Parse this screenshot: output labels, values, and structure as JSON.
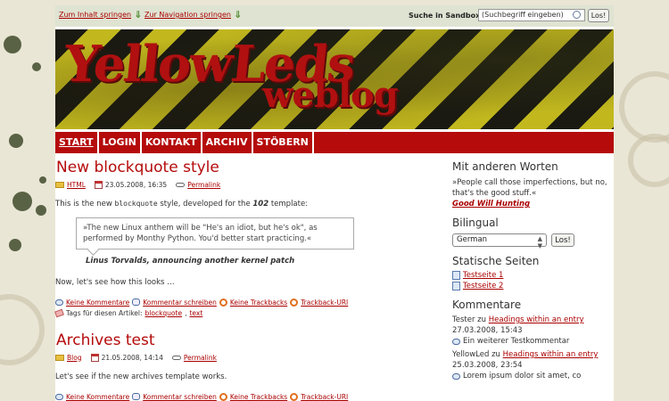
{
  "skiplinks": {
    "content": "Zum Inhalt springen",
    "navigation": "Zur Navigation springen"
  },
  "search": {
    "label": "Suche in Sandbox:",
    "value": "(Suchbegriff eingeben)",
    "button": "Los!"
  },
  "banner": {
    "logo_line1": "YellowLeds",
    "logo_line2": "weblog"
  },
  "nav": [
    "START",
    "LOGIN",
    "KONTAKT",
    "ARCHIV",
    "STÖBERN"
  ],
  "posts": [
    {
      "title": "New blockquote style",
      "category": "HTML",
      "date": "23.05.2008, 16:35",
      "permalink": "Permalink",
      "intro_a": "This is the new ",
      "intro_code": "blockquote",
      "intro_b": " style, developed for the ",
      "intro_num": "102",
      "intro_c": " template:",
      "quote": "»The new Linux anthem will be \"He's an idiot, but he's ok\", as performed by Monthy Python. You'd better start practicing.«",
      "cite": "Linus Torvalds, announcing another kernel patch",
      "after": "Now, let's see how this looks …",
      "links": [
        "Keine Kommentare",
        "Kommentar schreiben",
        "Keine Trackbacks",
        "Trackback-URI"
      ],
      "tags_label": "Tags für diesen Artikel:",
      "tags": [
        "blockquote",
        "text"
      ]
    },
    {
      "title": "Archives test",
      "category": "Blog",
      "date": "21.05.2008, 14:14",
      "permalink": "Permalink",
      "body": "Let's see if the new archives template works.",
      "links": [
        "Keine Kommentare",
        "Kommentar schreiben",
        "Keine Trackbacks",
        "Trackback-URI"
      ]
    }
  ],
  "sidebar": {
    "quote_heading": "Mit anderen Worten",
    "quote_text": "»People call those imperfections, but no, that's the good stuff.«",
    "quote_source": "Good Will Hunting",
    "lang_heading": "Bilingual",
    "lang_value": "German",
    "lang_button": "Los!",
    "pages_heading": "Statische Seiten",
    "pages": [
      "Testseite 1",
      "Testseite 2"
    ],
    "comments_heading": "Kommentare",
    "comments": [
      {
        "author": "Tester",
        "zu": "zu",
        "entry": "Headings within an entry",
        "date": "27.03.2008, 15:43",
        "text": "Ein weiterer Testkommentar"
      },
      {
        "author": "YellowLed",
        "zu": "zu",
        "entry": "Headings within an entry",
        "date": "25.03.2008, 23:54",
        "text": "Lorem ipsum dolor sit amet, co"
      }
    ]
  },
  "colors": {
    "accent": "#b50b0b",
    "link": "#aa0000",
    "background": "#e9e6d6"
  }
}
